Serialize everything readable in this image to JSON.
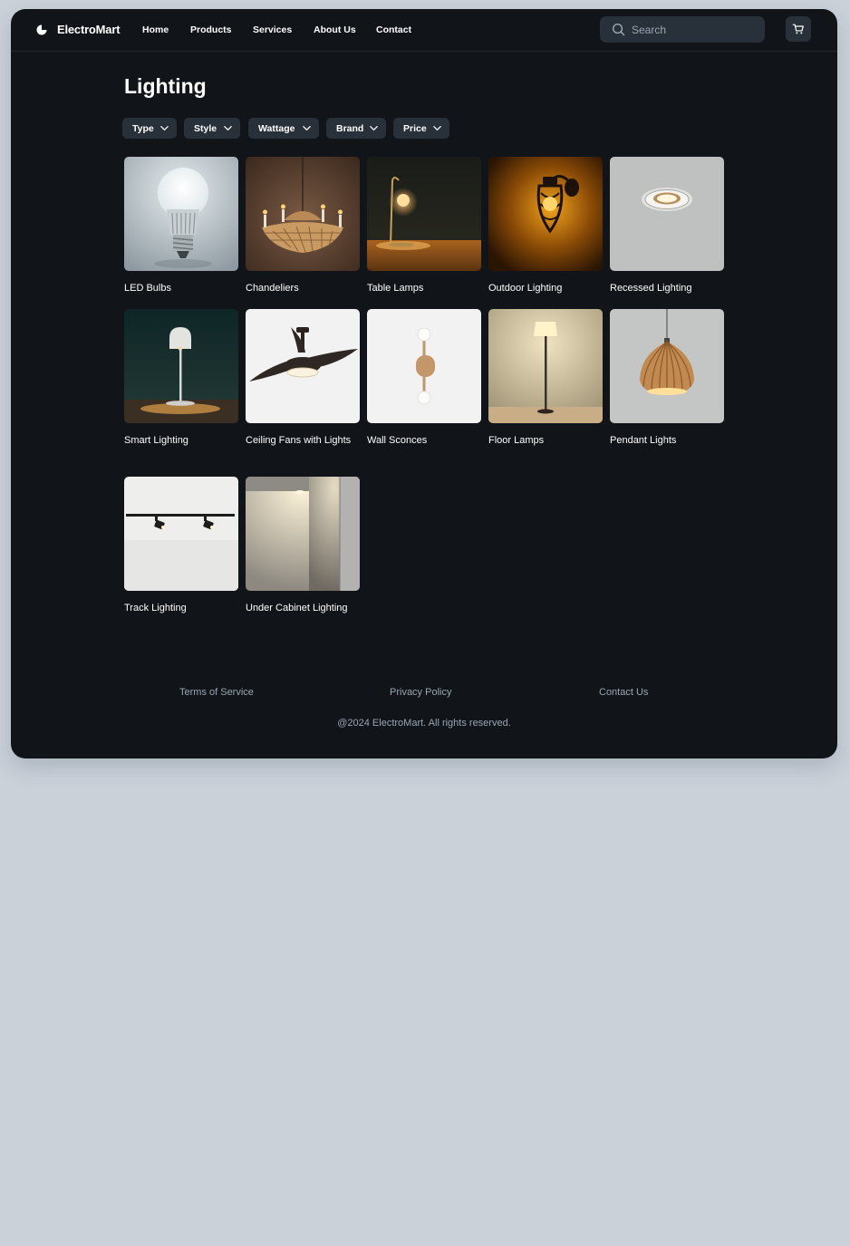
{
  "brand": {
    "name": "ElectroMart",
    "logo_icon": "electromart-logo-icon"
  },
  "nav": {
    "items": [
      {
        "label": "Home"
      },
      {
        "label": "Products"
      },
      {
        "label": "Services"
      },
      {
        "label": "About Us"
      },
      {
        "label": "Contact"
      }
    ]
  },
  "search": {
    "placeholder": "Search",
    "value": "",
    "icon": "search-icon"
  },
  "cart": {
    "icon": "cart-icon"
  },
  "page": {
    "title": "Lighting"
  },
  "filters": [
    {
      "label": "Type"
    },
    {
      "label": "Style"
    },
    {
      "label": "Wattage"
    },
    {
      "label": "Brand"
    },
    {
      "label": "Price"
    }
  ],
  "categories": [
    {
      "label": "LED Bulbs"
    },
    {
      "label": "Chandeliers"
    },
    {
      "label": "Table Lamps"
    },
    {
      "label": "Outdoor Lighting"
    },
    {
      "label": "Recessed Lighting"
    },
    {
      "label": "Smart Lighting"
    },
    {
      "label": "Ceiling Fans with Lights"
    },
    {
      "label": "Wall Sconces"
    },
    {
      "label": "Floor Lamps"
    },
    {
      "label": "Pendant Lights"
    },
    {
      "label": "Track Lighting"
    },
    {
      "label": "Under Cabinet Lighting"
    }
  ],
  "footer": {
    "links": [
      {
        "label": "Terms of Service"
      },
      {
        "label": "Privacy Policy"
      },
      {
        "label": "Contact Us"
      }
    ],
    "copyright": "@2024 ElectroMart. All rights reserved."
  },
  "colors": {
    "page_background": "#cad1d9",
    "app_background": "#111418",
    "control_background": "#283039",
    "text_primary": "#ffffff",
    "text_muted": "#9aa6b4"
  }
}
